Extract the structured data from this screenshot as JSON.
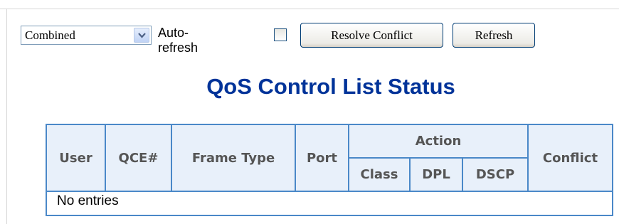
{
  "toolbar": {
    "select_value": "Combined",
    "auto_refresh_label": "Auto-refresh",
    "auto_refresh_checked": false,
    "resolve_label": "Resolve Conflict",
    "refresh_label": "Refresh"
  },
  "page_title": "QoS Control List Status",
  "table": {
    "headers": {
      "user": "User",
      "qce": "QCE#",
      "frame_type": "Frame Type",
      "port": "Port",
      "action": "Action",
      "class": "Class",
      "dpl": "DPL",
      "dscp": "DSCP",
      "conflict": "Conflict"
    },
    "rows": [],
    "empty_text": "No entries"
  },
  "colors": {
    "title": "#003399",
    "table_border": "#4a88c8",
    "header_bg": "#e8f0fa",
    "header_text": "#555555"
  }
}
